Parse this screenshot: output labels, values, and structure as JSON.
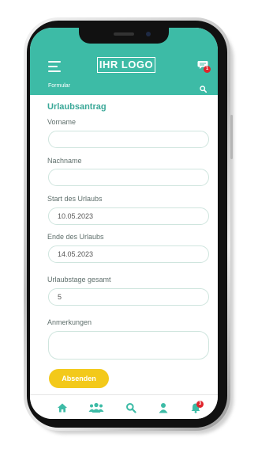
{
  "app": {
    "logo_text": "IHR LOGO",
    "section_label": "Formular",
    "chat_badge": "1"
  },
  "form": {
    "title": "Urlaubsantrag",
    "fields": [
      {
        "label": "Vorname",
        "value": ""
      },
      {
        "label": "Nachname",
        "value": ""
      },
      {
        "label": "Start des Urlaubs",
        "value": "10.05.2023"
      },
      {
        "label": "Ende des Urlaubs",
        "value": "14.05.2023"
      },
      {
        "label": "Urlaubstage gesamt",
        "value": "5"
      },
      {
        "label": "Anmerkungen",
        "value": ""
      }
    ],
    "submit_label": "Absenden"
  },
  "bottom_nav": {
    "items": [
      "home-icon",
      "users-icon",
      "search-icon",
      "profile-icon",
      "notifications-icon"
    ],
    "notification_badge": "3"
  },
  "colors": {
    "primary": "#3dbba6",
    "title": "#3aa898",
    "button": "#f3c91a",
    "badge": "#e0242b"
  }
}
